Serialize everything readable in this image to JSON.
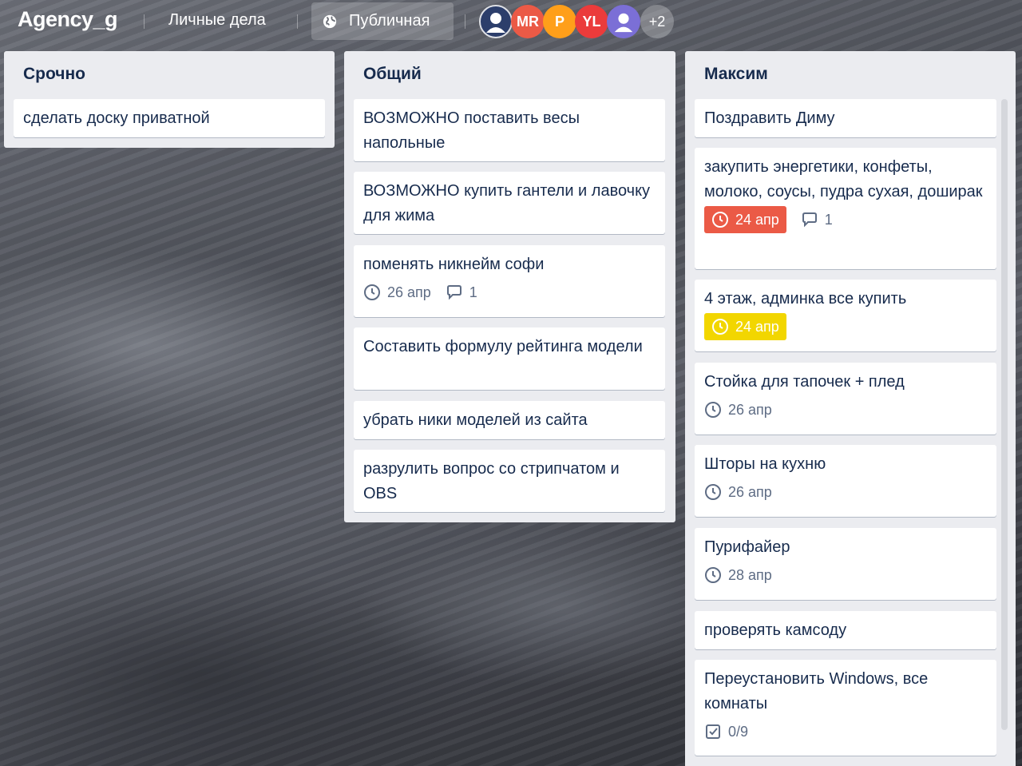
{
  "header": {
    "board_title": "Agency_g",
    "workspace": "Личные дела",
    "visibility": "Публичная",
    "members": [
      {
        "initials": "",
        "color": "#2c3e6b",
        "icon": "user-avatar-icon"
      },
      {
        "initials": "MR",
        "color": "#eb5a46"
      },
      {
        "initials": "P",
        "color": "#ff9f1a"
      },
      {
        "initials": "YL",
        "color": "#eb3b3b"
      },
      {
        "initials": "",
        "color": "#7b6fd6",
        "icon": "user-avatar-icon"
      }
    ],
    "more_members": "+2"
  },
  "lists": [
    {
      "title": "Срочно",
      "cards": [
        {
          "title": "сделать доску приватной"
        }
      ]
    },
    {
      "title": "Общий",
      "cards": [
        {
          "title": "ВОЗМОЖНО поставить весы напольные"
        },
        {
          "title": "ВОЗМОЖНО купить гантели и лавочку для жима"
        },
        {
          "title": "поменять никнейм софи",
          "due": "26 апр",
          "comments": "1"
        },
        {
          "title": "Составить формулу рейтинга модели"
        },
        {
          "title": "убрать ники моделей из сайта"
        },
        {
          "title": "разрулить вопрос со стрипчатом и OBS"
        }
      ]
    },
    {
      "title": "Максим",
      "cards": [
        {
          "title": "Поздравить Диму"
        },
        {
          "title": "закупить энергетики, конфеты, молоко, соусы, пудра сухая, доширак",
          "due": "24 апр",
          "due_status": "overdue",
          "comments": "1"
        },
        {
          "title": "4 этаж, админка все купить",
          "due": "24 апр",
          "due_status": "due-soon"
        },
        {
          "title": "Стойка для тапочек + плед",
          "due": "26 апр"
        },
        {
          "title": "Шторы на кухню",
          "due": "26 апр"
        },
        {
          "title": "Пурифайер",
          "due": "28 апр"
        },
        {
          "title": "проверять камсоду"
        },
        {
          "title": "Переустановить Windows, все комнаты",
          "checklist": "0/9"
        }
      ]
    }
  ],
  "colors": {
    "overdue": "#eb5a46",
    "due_soon": "#f2d600",
    "list_bg": "#ebecf0",
    "text": "#172b4d"
  }
}
